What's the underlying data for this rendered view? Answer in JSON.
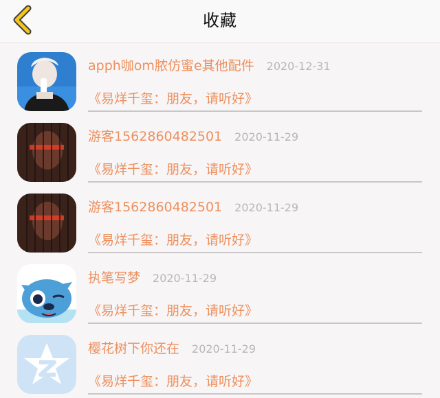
{
  "header": {
    "title": "收藏",
    "back_icon": "chevron-left-icon",
    "accent": "#f5c518"
  },
  "items": [
    {
      "name": "apph咖om脓仿蜜e其他配件",
      "date": "2020-12-31",
      "song": "《易烊千玺：朋友，请听好》",
      "avatar": "photo-person-drinking"
    },
    {
      "name": "游客1562860482501",
      "date": "2020-11-29",
      "song": "《易烊千玺：朋友，请听好》",
      "avatar": "photo-dark-portrait"
    },
    {
      "name": "游客1562860482501",
      "date": "2020-11-29",
      "song": "《易烊千玺：朋友，请听好》",
      "avatar": "photo-dark-portrait"
    },
    {
      "name": "执笔写梦",
      "date": "2020-11-29",
      "song": "《易烊千玺：朋友，请听好》",
      "avatar": "cartoon-stitch"
    },
    {
      "name": "樱花树下你还在",
      "date": "2020-11-29",
      "song": "《易烊千玺：朋友，请听好》",
      "avatar": "qzone-star-logo"
    }
  ]
}
